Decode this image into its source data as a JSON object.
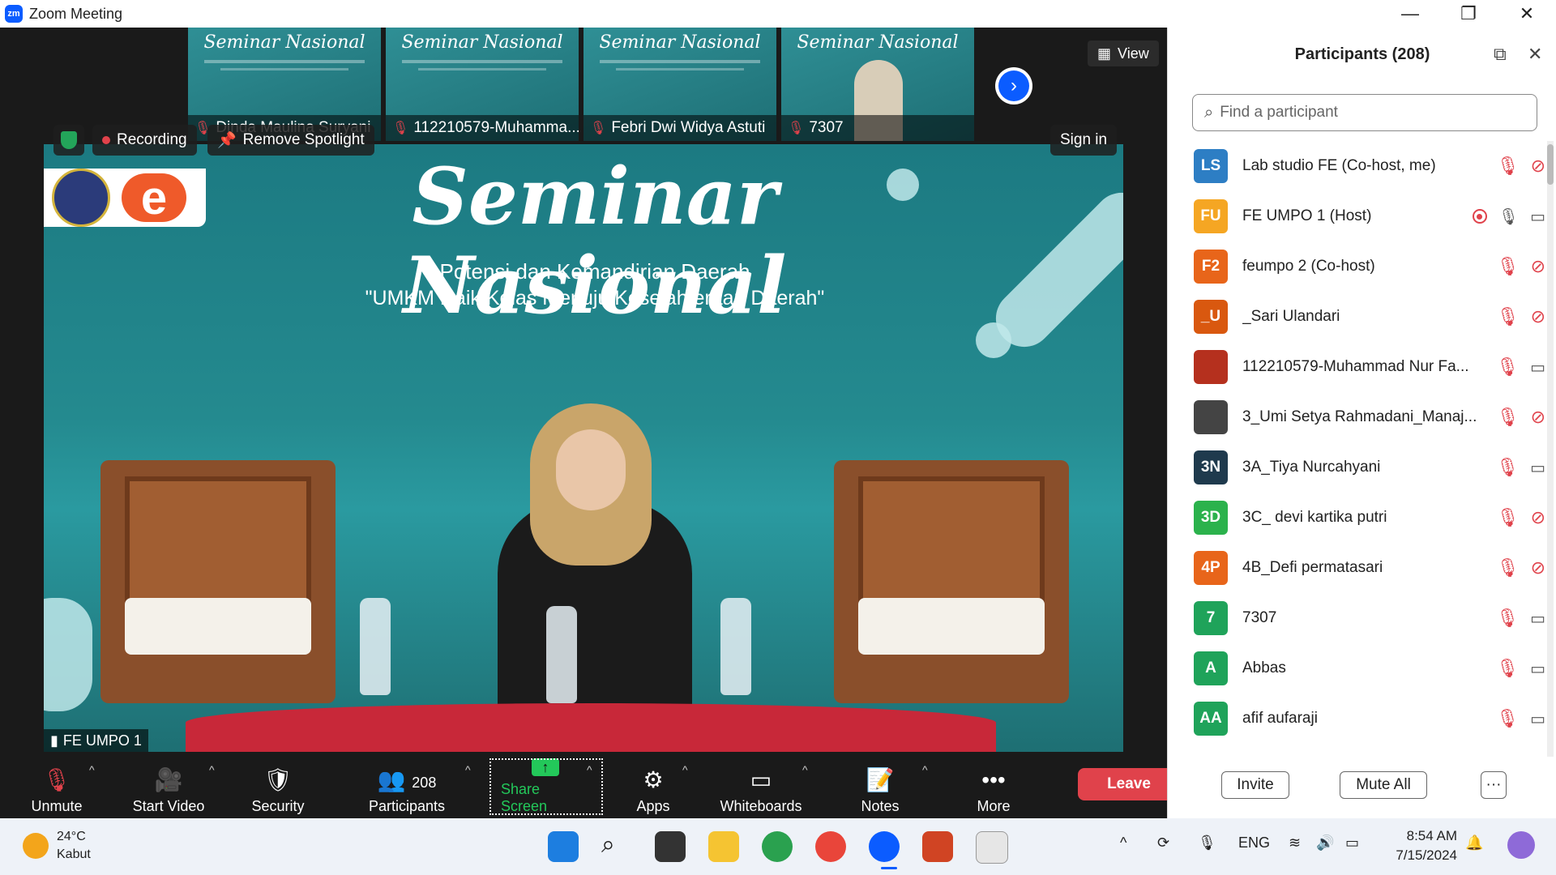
{
  "window": {
    "title": "Zoom Meeting",
    "logo_text": "zm"
  },
  "thumbnails": [
    {
      "name": "Dinda Maulina Suryani",
      "slide_title": "Seminar Nasional"
    },
    {
      "name": "112210579-Muhamma...",
      "slide_title": "Seminar Nasional"
    },
    {
      "name": "Febri Dwi Widya Astuti",
      "slide_title": "Seminar Nasional"
    },
    {
      "name": "7307",
      "slide_title": "Seminar Nasional"
    }
  ],
  "view_label": "View",
  "main_video": {
    "title": "Seminar Nasional",
    "subtitle1": "Potensi dan Kemandirian Daerah",
    "subtitle2": "\"UMKM Naik Kelas Menuju Kesejahteraan Daerah\"",
    "logo_letter": "e",
    "speaker_name": "FE UMPO 1"
  },
  "overlay": {
    "recording": "Recording",
    "remove_spotlight": "Remove Spotlight",
    "sign_in": "Sign in"
  },
  "toolbar": {
    "unmute": "Unmute",
    "start_video": "Start Video",
    "security": "Security",
    "participants": "Participants",
    "participants_count": "208",
    "share_screen": "Share Screen",
    "apps": "Apps",
    "whiteboards": "Whiteboards",
    "notes": "Notes",
    "more": "More",
    "leave": "Leave"
  },
  "panel": {
    "title": "Participants (208)",
    "search_placeholder": "Find a participant",
    "invite": "Invite",
    "mute_all": "Mute All",
    "more": "···",
    "participants": [
      {
        "initials": "LS",
        "name": "Lab studio FE (Co-host, me)",
        "color": "#2d7ec4",
        "mic": "off",
        "video": "off"
      },
      {
        "initials": "FU",
        "name": "FE UMPO 1 (Host)",
        "color": "#f5a623",
        "mic": "on",
        "video": "on",
        "recording": true
      },
      {
        "initials": "F2",
        "name": "feumpo 2 (Co-host)",
        "color": "#e8651a",
        "mic": "off",
        "video": "off"
      },
      {
        "initials": "_U",
        "name": "_Sari Ulandari",
        "color": "#d9580f",
        "mic": "off",
        "video": "off"
      },
      {
        "initials": "",
        "name": "112210579-Muhammad Nur Fa...",
        "color": "#b5301e",
        "mic": "off",
        "video": "on",
        "photo": true
      },
      {
        "initials": "",
        "name": "3_Umi Setya Rahmadani_Manaj...",
        "color": "#444444",
        "mic": "off",
        "video": "off",
        "photo": true
      },
      {
        "initials": "3N",
        "name": "3A_Tiya Nurcahyani",
        "color": "#1f3a4d",
        "mic": "off",
        "video": "on"
      },
      {
        "initials": "3D",
        "name": "3C_ devi kartika putri",
        "color": "#2bb24c",
        "mic": "off",
        "video": "off"
      },
      {
        "initials": "4P",
        "name": "4B_Defi permatasari",
        "color": "#e8651a",
        "mic": "off",
        "video": "off"
      },
      {
        "initials": "7",
        "name": "7307",
        "color": "#1fa35a",
        "mic": "off",
        "video": "on"
      },
      {
        "initials": "A",
        "name": "Abbas",
        "color": "#1fa35a",
        "mic": "off",
        "video": "on"
      },
      {
        "initials": "AA",
        "name": "afif aufaraji",
        "color": "#1fa35a",
        "mic": "off",
        "video": "on"
      }
    ]
  },
  "taskbar": {
    "temperature": "24°C",
    "weather": "Kabut",
    "lang": "ENG",
    "time": "8:54 AM",
    "date": "7/15/2024"
  }
}
